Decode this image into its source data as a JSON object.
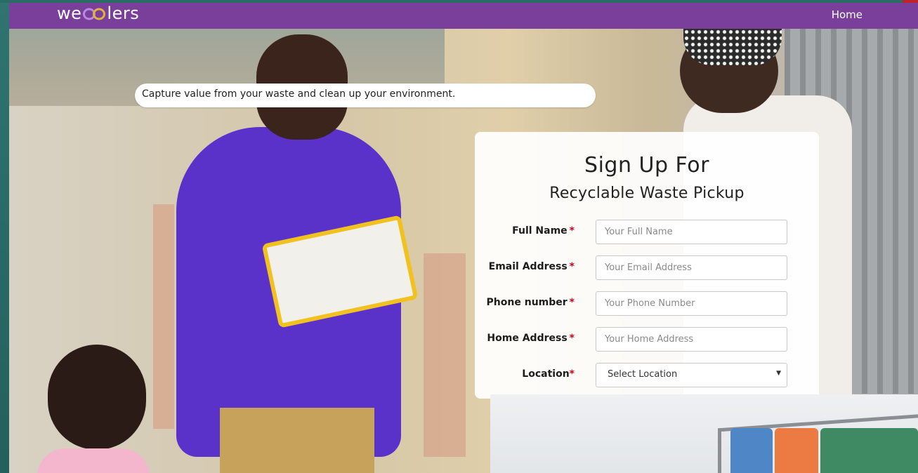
{
  "navbar": {
    "brand": {
      "before_logo": "we",
      "after_logo": "lers"
    },
    "home_link": "Home"
  },
  "hero": {
    "tagline": "Capture value from your waste and clean up your environment."
  },
  "signup_form": {
    "title": "Sign Up For",
    "subtitle": "Recyclable Waste Pickup",
    "required_marker": "*",
    "fields": [
      {
        "label": "Full Name",
        "placeholder": "Your Full Name"
      },
      {
        "label": "Email Address",
        "placeholder": "Your Email Address"
      },
      {
        "label": "Phone number",
        "placeholder": "Your Phone Number"
      },
      {
        "label": "Home Address",
        "placeholder": "Your Home Address"
      }
    ],
    "location": {
      "label": "Location",
      "selected": "Select Location",
      "caret": "▼"
    }
  },
  "colors": {
    "navbar": "#7a3f9b",
    "background": "#2d6a66",
    "required": "#d0021b",
    "logo_purple": "#8b5fbf",
    "logo_gold": "#e0b43a"
  },
  "icons": {
    "logo": "infinity-loop-logo-icon",
    "select_caret": "chevron-down-icon"
  }
}
